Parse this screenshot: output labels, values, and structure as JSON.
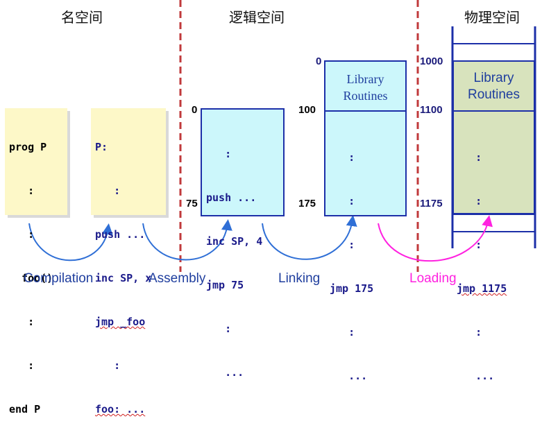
{
  "headings": {
    "name_space": "名空间",
    "logical_space": "逻辑空间",
    "physical_space": "物理空间"
  },
  "source_box": {
    "lines": [
      "prog P",
      "   :",
      "   :",
      "  foo()",
      "   :",
      "   :",
      "end P"
    ]
  },
  "assembly_box": {
    "lines": [
      "P:",
      "   :",
      "push ...",
      "inc SP, x",
      "jmp _foo",
      "   :",
      "foo: ..."
    ]
  },
  "object_box": {
    "addr_top": "0",
    "addr_bottom": "75",
    "lines": [
      "   :",
      "push ...",
      "inc SP, 4",
      "jmp 75",
      "   :",
      "   ..."
    ]
  },
  "linked_box": {
    "addr_top": "0",
    "addr_mid": "100",
    "addr_bottom": "175",
    "library_title_line1": "Library",
    "library_title_line2": "Routines",
    "lines": [
      "   :",
      "   :",
      "   :",
      "jmp 175",
      "   :",
      "   ..."
    ]
  },
  "physical_box": {
    "addr_top": "1000",
    "addr_mid": "1100",
    "addr_bottom": "1175",
    "library_title_line1": "Library",
    "library_title_line2": "Routines",
    "lines": [
      "   :",
      "   :",
      "   :",
      "jmp 1175",
      "   :",
      "   ..."
    ]
  },
  "stages": {
    "compilation": "Compilation",
    "assembly": "Assembly",
    "linking": "Linking",
    "loading": "Loading"
  },
  "colors": {
    "arrow_blue": "#2f6fd6",
    "arrow_magenta": "#ff22e0",
    "stage_text_blue": "#1f3e9e",
    "stage_text_magenta": "#ff22e0",
    "divider_red": "#c0393b",
    "code_blue": "#1a1a8a",
    "code_black": "#000000",
    "memory_frame": "#1c2fa8"
  }
}
